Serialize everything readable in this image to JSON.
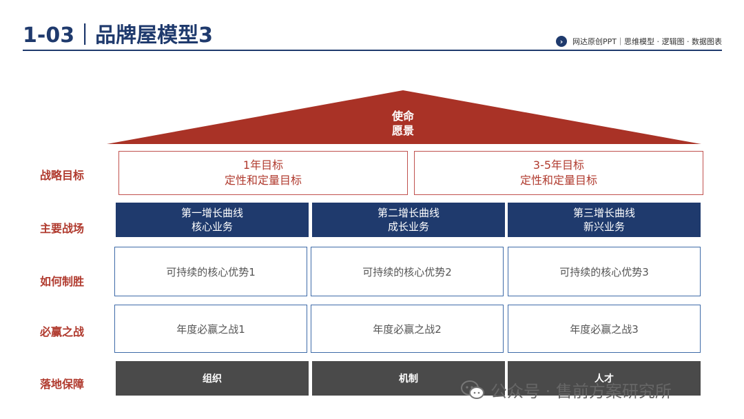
{
  "header": {
    "title": "1-03｜品牌屋模型3",
    "subtitle": "网达原创PPT｜思维模型 · 逻辑图 · 数据图表",
    "subtitle_icon": "chevron-right-circle-icon"
  },
  "roof": {
    "line1": "使命",
    "line2": "愿景",
    "color": "#a93226"
  },
  "rows": {
    "goals": {
      "label": "战略目标",
      "items": [
        {
          "line1": "1年目标",
          "line2": "定性和定量目标"
        },
        {
          "line1": "3-5年目标",
          "line2": "定性和定量目标"
        }
      ]
    },
    "fields": {
      "label": "主要战场",
      "items": [
        {
          "line1": "第一增长曲线",
          "line2": "核心业务"
        },
        {
          "line1": "第二增长曲线",
          "line2": "成长业务"
        },
        {
          "line1": "第三增长曲线",
          "line2": "新兴业务"
        }
      ]
    },
    "how": {
      "label": "如何制胜",
      "items": [
        "可持续的核心优势1",
        "可持续的核心优势2",
        "可持续的核心优势3"
      ]
    },
    "battles": {
      "label": "必赢之战",
      "items": [
        "年度必赢之战1",
        "年度必赢之战2",
        "年度必赢之战3"
      ]
    },
    "support": {
      "label": "落地保障",
      "items": [
        "组织",
        "机制",
        "人才"
      ]
    }
  },
  "colors": {
    "navy": "#1f3a6d",
    "red": "#b03a2e",
    "dark_gray": "#4a4a4a",
    "box_border": "#3d6aa8"
  },
  "watermark": {
    "text": "公众号 · 售前方案研究所",
    "icon": "wechat-icon"
  }
}
